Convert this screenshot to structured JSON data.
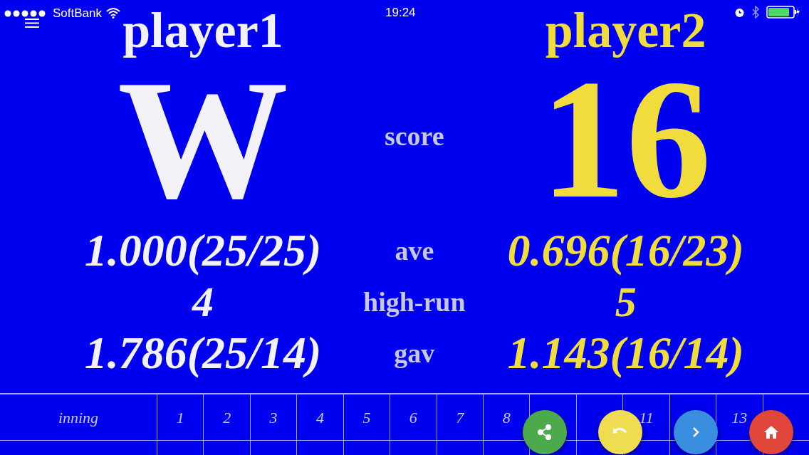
{
  "status_bar": {
    "carrier": "SoftBank",
    "time": "19:24"
  },
  "players": [
    {
      "name": "player1",
      "score": "W",
      "color": "#f2f2f8",
      "ave": "1.000(25/25)",
      "high_run": "4",
      "gav": "1.786(25/14)"
    },
    {
      "name": "player2",
      "score": "16",
      "color": "#f0dc3c",
      "ave": "0.696(16/23)",
      "high_run": "5",
      "gav": "1.143(16/14)"
    }
  ],
  "labels": {
    "score": "score",
    "ave": "ave",
    "high_run": "high-run",
    "gav": "gav"
  },
  "table": {
    "rows": [
      {
        "cells": [
          {
            "text": "inning"
          },
          {
            "text": "1"
          },
          {
            "text": "2"
          },
          {
            "text": "3"
          },
          {
            "text": "4"
          },
          {
            "text": "5"
          },
          {
            "text": "6"
          },
          {
            "text": "7"
          },
          {
            "text": "8"
          },
          {},
          {},
          {
            "text": "11"
          },
          {},
          {
            "text": "13"
          },
          {}
        ]
      }
    ]
  },
  "fab_buttons": [
    {
      "kind": "share",
      "color": "#4caa4c"
    },
    {
      "kind": "undo",
      "color": "#f0dc50"
    },
    {
      "kind": "next",
      "color": "#3a8ee0"
    },
    {
      "kind": "home",
      "color": "#e0463a"
    }
  ]
}
